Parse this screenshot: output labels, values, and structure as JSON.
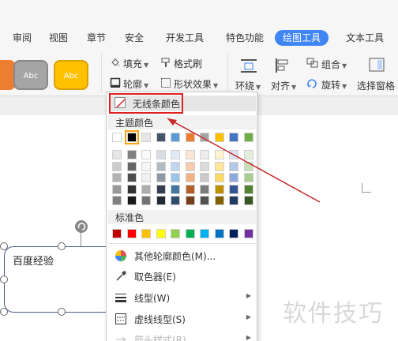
{
  "tabs": [
    {
      "label": "审阅"
    },
    {
      "label": "视图"
    },
    {
      "label": "章节"
    },
    {
      "label": "安全"
    },
    {
      "label": "开发工具"
    },
    {
      "label": "特色功能"
    },
    {
      "label": "绘图工具"
    },
    {
      "label": "文本工具"
    }
  ],
  "ribbon": {
    "styles": [
      "Abc",
      "Abc",
      "Abc"
    ],
    "fill_label": "填充",
    "format_painter_label": "格式刷",
    "outline_label": "轮廓",
    "shape_effect_label": "形状效果",
    "wrap_label": "环绕",
    "align_label": "对齐",
    "group_label": "组合",
    "rotate_label": "旋转",
    "selection_pane_label": "选择窗格"
  },
  "menu": {
    "no_line_label": "无线条颜色",
    "theme_colors_title": "主题颜色",
    "standard_colors_title": "标准色",
    "items": [
      {
        "label": "其他轮廓颜色(M)..."
      },
      {
        "label": "取色器(E)"
      },
      {
        "label": "线型(W)"
      },
      {
        "label": "虚线线型(S)"
      },
      {
        "label": "箭头样式(R)"
      }
    ]
  },
  "canvas": {
    "shape_text": "百度经验"
  },
  "watermark": "软件技巧",
  "colors": {
    "accent": "#3f85f3",
    "highlight": "#e02020",
    "theme_top": [
      "#ffffff",
      "#000000",
      "#e7e6e6",
      "#44546a",
      "#5b9bd5",
      "#ed7d31",
      "#a5a5a5",
      "#ffc000",
      "#4472c4",
      "#70ad47"
    ],
    "standard": [
      "#c00000",
      "#ff0000",
      "#ffc000",
      "#ffff00",
      "#92d050",
      "#00b050",
      "#00b0f0",
      "#0070c0",
      "#002060",
      "#7030a0"
    ]
  }
}
